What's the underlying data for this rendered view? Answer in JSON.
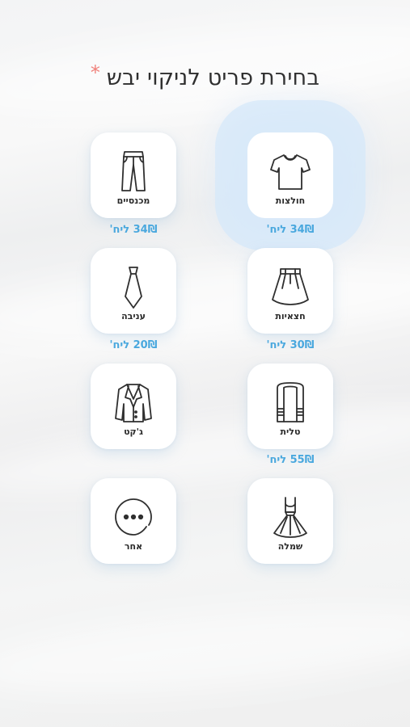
{
  "header": {
    "title": "בחירת פריט לניקוי יבש",
    "required_mark": "*"
  },
  "items": [
    {
      "id": "shirts",
      "label": "חולצות",
      "price": "34₪ ליח'",
      "icon": "tshirt-icon",
      "selected": true
    },
    {
      "id": "pants",
      "label": "מכנסיים",
      "price": "34₪ ליח'",
      "icon": "pants-icon",
      "selected": false
    },
    {
      "id": "skirts",
      "label": "חצאיות",
      "price": "30₪ ליח'",
      "icon": "skirt-icon",
      "selected": false
    },
    {
      "id": "tie",
      "label": "עניבה",
      "price": "20₪ ליח'",
      "icon": "tie-icon",
      "selected": false
    },
    {
      "id": "tallit",
      "label": "טלית",
      "price": "55₪ ליח'",
      "icon": "tallit-icon",
      "selected": false
    },
    {
      "id": "jacket",
      "label": "ג'קט",
      "price": "",
      "icon": "jacket-icon",
      "selected": false
    },
    {
      "id": "dress",
      "label": "שמלה",
      "price": "",
      "icon": "dress-icon",
      "selected": false
    },
    {
      "id": "other",
      "label": "אחר",
      "price": "",
      "icon": "more-icon",
      "selected": false
    }
  ],
  "colors": {
    "price": "#4aa8de",
    "required": "#f0807a",
    "selected_glow": "#d6e8fa"
  }
}
